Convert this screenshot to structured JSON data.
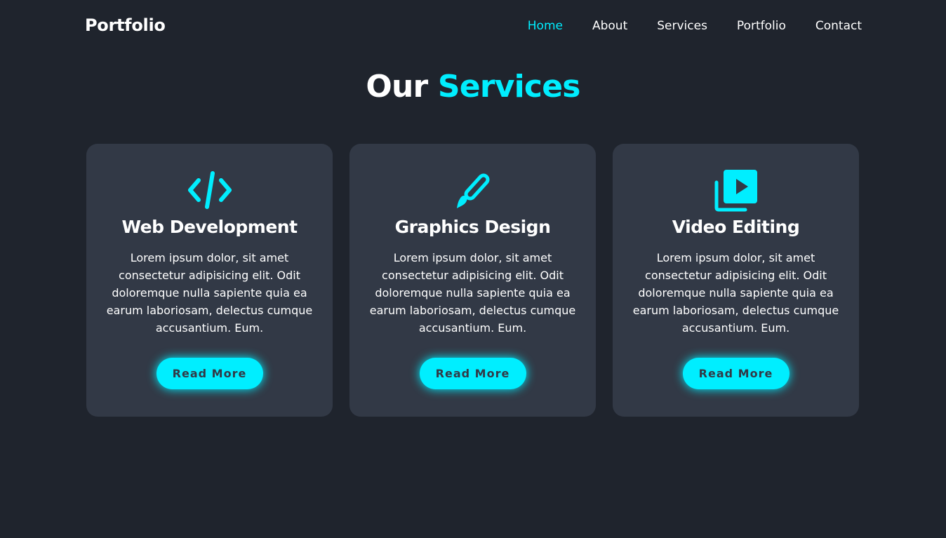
{
  "header": {
    "logo": "Portfolio",
    "nav": [
      {
        "label": "Home",
        "active": true
      },
      {
        "label": "About",
        "active": false
      },
      {
        "label": "Services",
        "active": false
      },
      {
        "label": "Portfolio",
        "active": false
      },
      {
        "label": "Contact",
        "active": false
      }
    ]
  },
  "section": {
    "title_main": "Our",
    "title_accent": "Services"
  },
  "cards": [
    {
      "icon": "code-icon",
      "title": "Web Development",
      "text": "Lorem ipsum dolor, sit amet consectetur adipisicing elit. Odit doloremque nulla sapiente quia ea earum laboriosam, delectus cumque accusantium. Eum.",
      "button": "Read More"
    },
    {
      "icon": "paint-brush-icon",
      "title": "Graphics Design",
      "text": "Lorem ipsum dolor, sit amet consectetur adipisicing elit. Odit doloremque nulla sapiente quia ea earum laboriosam, delectus cumque accusantium. Eum.",
      "button": "Read More"
    },
    {
      "icon": "video-library-icon",
      "title": "Video Editing",
      "text": "Lorem ipsum dolor, sit amet consectetur adipisicing elit. Odit doloremque nulla sapiente quia ea earum laboriosam, delectus cumque accusantium. Eum.",
      "button": "Read More"
    }
  ],
  "colors": {
    "accent": "#00eeff",
    "background": "#1f242d",
    "card_background": "#323946",
    "text": "#ffffff"
  }
}
